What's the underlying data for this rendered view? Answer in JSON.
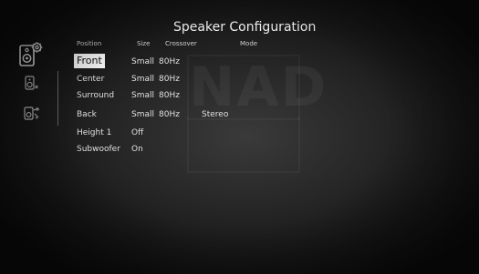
{
  "screen": {
    "title": "Speaker Configuration",
    "watermark": "NAD"
  },
  "sidebar": {
    "items": [
      {
        "icon": "speaker-gear-icon",
        "selected": true
      },
      {
        "icon": "speaker-small-icon",
        "selected": false
      },
      {
        "icon": "speaker-tools-icon",
        "selected": false
      }
    ]
  },
  "table": {
    "headers": {
      "position": "Position",
      "size": "Size",
      "crossover": "Crossover",
      "mode": "Mode"
    },
    "rows": [
      {
        "position": "Front",
        "size": "Small",
        "crossover": "80Hz",
        "mode": "",
        "selected": true
      },
      {
        "position": "Center",
        "size": "Small",
        "crossover": "80Hz",
        "mode": ""
      },
      {
        "position": "Surround",
        "size": "Small",
        "crossover": "80Hz",
        "mode": ""
      },
      {
        "position": "Back",
        "size": "Small",
        "crossover": "80Hz",
        "mode": "Stereo"
      },
      {
        "position": "Height 1",
        "size": "Off",
        "crossover": "",
        "mode": ""
      },
      {
        "position": "Subwoofer",
        "size": "On",
        "crossover": "",
        "mode": ""
      }
    ]
  },
  "colors": {
    "background": "#262626",
    "text": "#e6e6e6",
    "selection_bg": "#fafafa",
    "selection_text": "#111111"
  }
}
